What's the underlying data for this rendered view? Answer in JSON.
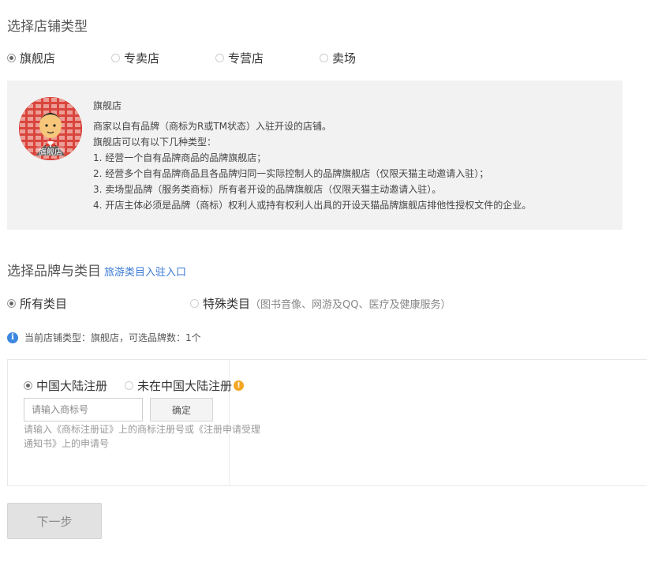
{
  "store_section": {
    "title": "选择店铺类型",
    "options": [
      {
        "label": "旗舰店",
        "checked": true
      },
      {
        "label": "专卖店",
        "checked": false
      },
      {
        "label": "专营店",
        "checked": false
      },
      {
        "label": "卖场",
        "checked": false
      }
    ]
  },
  "store_info": {
    "badge_label": "旗舰店",
    "heading": "旗舰店",
    "lines": [
      "商家以自有品牌（商标为R或TM状态）入驻开设的店铺。",
      "旗舰店可以有以下几种类型：",
      "1. 经营一个自有品牌商品的品牌旗舰店；",
      "2. 经营多个自有品牌商品且各品牌归同一实际控制人的品牌旗舰店（仅限天猫主动邀请入驻）；",
      "3. 卖场型品牌（服务类商标）所有者开设的品牌旗舰店（仅限天猫主动邀请入驻）。",
      "4. 开店主体必须是品牌（商标）权利人或持有权利人出具的开设天猫品牌旗舰店排他性授权文件的企业。"
    ]
  },
  "brand_section": {
    "title": "选择品牌与类目",
    "travel_link": "旅游类目入驻入口",
    "category_options": [
      {
        "label": "所有类目",
        "checked": true,
        "note": ""
      },
      {
        "label": "特殊类目",
        "checked": false,
        "note": "（图书音像、网游及QQ、医疗及健康服务）"
      }
    ],
    "notice": "当前店铺类型：旗舰店，可选品牌数：1个"
  },
  "brand_form": {
    "registration_options": [
      {
        "label": "中国大陆注册",
        "checked": true
      },
      {
        "label": "未在中国大陆注册",
        "checked": false
      }
    ],
    "trademark_placeholder": "请输入商标号",
    "confirm_label": "确定",
    "hint": "请输入《商标注册证》上的商标注册号或《注册申请受理通知书》上的申请号"
  },
  "footer": {
    "next_label": "下一步"
  },
  "colors": {
    "link": "#3b7ad6",
    "info_icon": "#3b88e0",
    "warn_icon": "#f5a623",
    "panel_bg": "#f2f2f2",
    "avatar_bg": "#d9453c"
  }
}
